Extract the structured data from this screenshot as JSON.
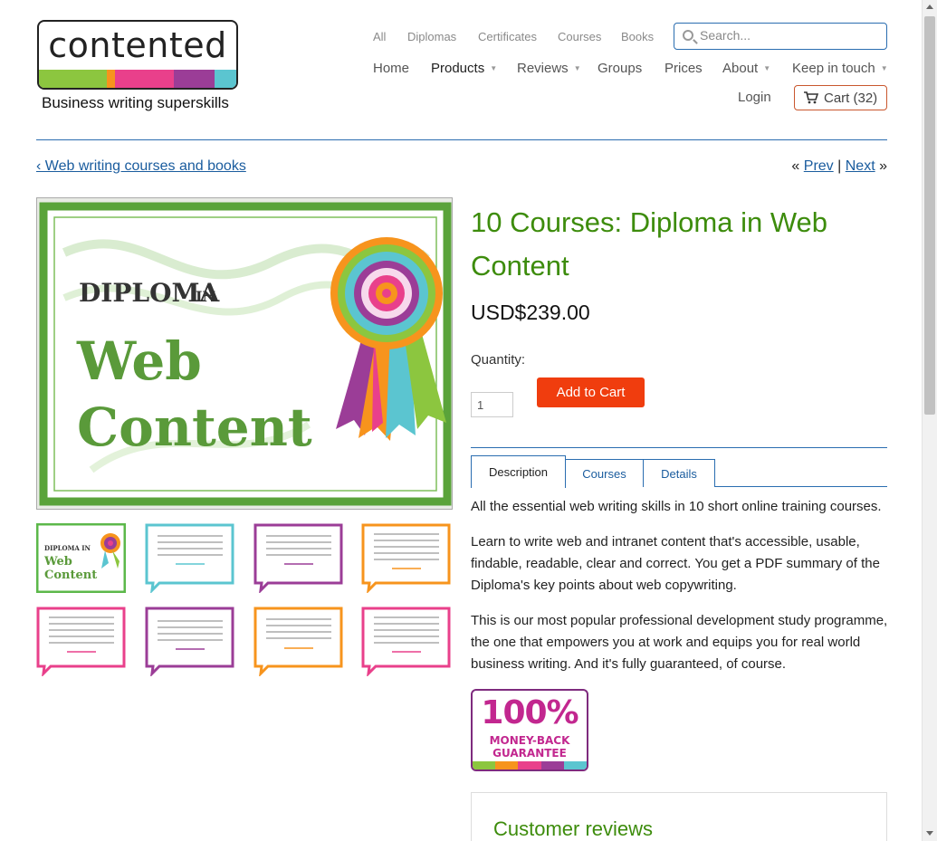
{
  "brand": {
    "logo_text": "contented",
    "tagline": "Business writing superskills",
    "stripe_colors": [
      "#8cc63f",
      "#f7941d",
      "#e9408b",
      "#9b3d97",
      "#5bc5d0"
    ]
  },
  "top_nav": {
    "items": [
      "All",
      "Diplomas",
      "Certificates",
      "Courses",
      "Books"
    ]
  },
  "search": {
    "placeholder": "Search..."
  },
  "main_nav": {
    "items": [
      {
        "label": "Home",
        "dropdown": false
      },
      {
        "label": "Products",
        "dropdown": true
      },
      {
        "label": "Reviews",
        "dropdown": true
      },
      {
        "label": "Groups",
        "dropdown": false
      },
      {
        "label": "Prices",
        "dropdown": false
      },
      {
        "label": "About",
        "dropdown": true
      },
      {
        "label": "Keep in touch",
        "dropdown": true
      }
    ],
    "login": "Login",
    "cart": "Cart (32)"
  },
  "breadcrumb": {
    "back": "‹ Web writing courses and books",
    "prev": "Prev",
    "next": "Next",
    "left_quote": "«",
    "separator": "|",
    "right_quote": "»"
  },
  "product": {
    "image": {
      "line1": "DIPLOMA",
      "line1_small": "IN",
      "line2": "Web",
      "line3": "Content"
    },
    "title": "10 Courses: Diploma in Web Content",
    "price": "USD$239.00",
    "quantity_label": "Quantity:",
    "quantity_value": "1",
    "add_to_cart": "Add to Cart",
    "thumbnail_frame_colors": [
      "#5cb84a",
      "#5bc5d0",
      "#9b3d97",
      "#f7941d",
      "#e9408b",
      "#9b3d97",
      "#f7941d",
      "#e9408b"
    ]
  },
  "tabs": [
    {
      "label": "Description",
      "active": true
    },
    {
      "label": "Courses",
      "active": false
    },
    {
      "label": "Details",
      "active": false
    }
  ],
  "description": {
    "p1": "All the essential web writing skills in 10 short online training courses.",
    "p2": "Learn to write web and intranet content that's accessible, usable, findable, readable, clear and correct. You get a PDF summary of the Diploma's key points about web copywriting.",
    "p3": "This is our most popular professional development study programme, the one that empowers you at work and equips you for real world business writing. And it's fully guaranteed, of course."
  },
  "guarantee_badge": {
    "big": "100%",
    "line1": "MONEY-BACK",
    "line2": "GUARANTEE"
  },
  "reviews": {
    "title": "Customer reviews"
  }
}
